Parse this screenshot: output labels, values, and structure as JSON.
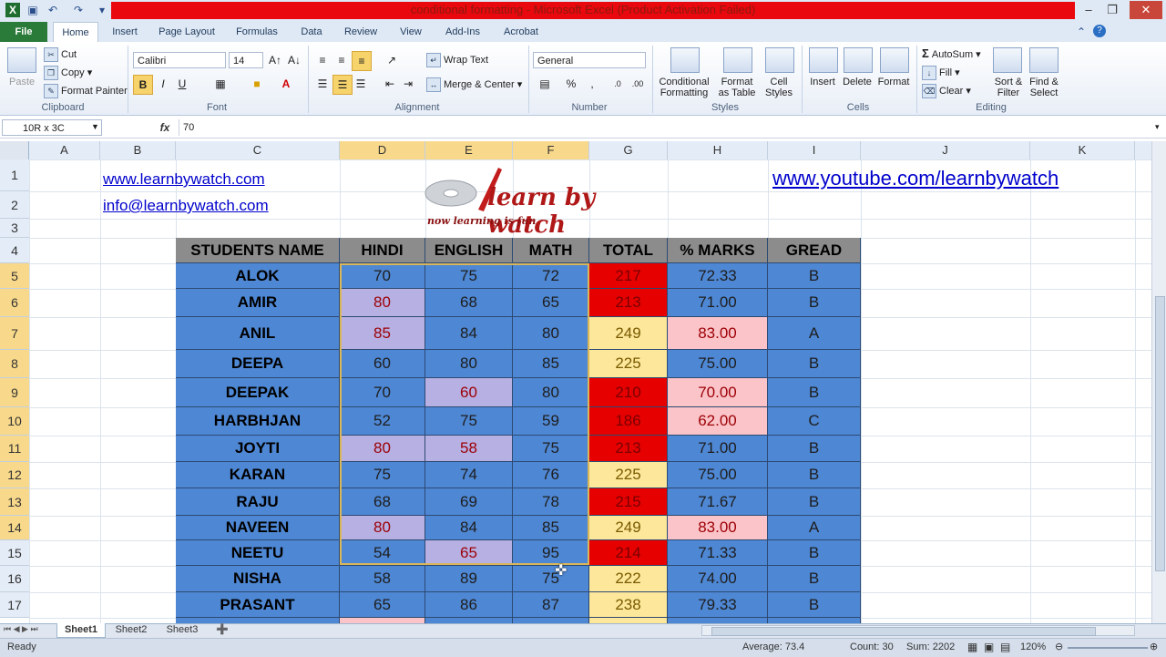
{
  "window": {
    "title": "conditional formatting - Microsoft Excel (Product Activation Failed)"
  },
  "ribbon_tabs": [
    "File",
    "Home",
    "Insert",
    "Page Layout",
    "Formulas",
    "Data",
    "Review",
    "View",
    "Add-Ins",
    "Acrobat"
  ],
  "clipboard": {
    "paste": "Paste",
    "cut": "Cut",
    "copy": "Copy",
    "format_painter": "Format Painter",
    "label": "Clipboard"
  },
  "font": {
    "name": "Calibri",
    "size": "14",
    "label": "Font"
  },
  "alignment": {
    "wrap": "Wrap Text",
    "merge": "Merge & Center",
    "label": "Alignment"
  },
  "number": {
    "format": "General",
    "label": "Number"
  },
  "styles": {
    "conditional": "Conditional",
    "conditional2": "Formatting",
    "format_table": "Format",
    "format_table2": "as Table",
    "cell_styles": "Cell",
    "cell_styles2": "Styles",
    "label": "Styles"
  },
  "cells": {
    "insert": "Insert",
    "delete": "Delete",
    "format": "Format",
    "label": "Cells"
  },
  "editing": {
    "autosum": "AutoSum",
    "fill": "Fill",
    "clear": "Clear",
    "sort": "Sort &",
    "sort2": "Filter",
    "find": "Find &",
    "find2": "Select",
    "label": "Editing"
  },
  "formula_bar": {
    "name_box": "10R x 3C",
    "fx": "fx",
    "value": "70"
  },
  "columns": [
    "A",
    "B",
    "C",
    "D",
    "E",
    "F",
    "G",
    "H",
    "I",
    "J",
    "K"
  ],
  "rows": [
    "1",
    "2",
    "3",
    "4",
    "5",
    "6",
    "7",
    "8",
    "9",
    "10",
    "11",
    "12",
    "13",
    "14",
    "15",
    "16",
    "17"
  ],
  "links": {
    "site": "www.learnbywatch.com",
    "email": "info@learnbywatch.com",
    "youtube": "www.youtube.com/learnbywatch"
  },
  "logo": {
    "text": "learn by watch",
    "tagline": "now learning is fun"
  },
  "table": {
    "headers": [
      "STUDENTS NAME",
      "HINDI",
      "ENGLISH",
      "MATH",
      "TOTAL",
      "% MARKS",
      "GREAD"
    ],
    "rows": [
      {
        "name": "ALOK",
        "hindi": "70",
        "english": "75",
        "math": "72",
        "total": "217",
        "marks": "72.33",
        "grade": "B"
      },
      {
        "name": "AMIR",
        "hindi": "80",
        "english": "68",
        "math": "65",
        "total": "213",
        "marks": "71.00",
        "grade": "B"
      },
      {
        "name": "ANIL",
        "hindi": "85",
        "english": "84",
        "math": "80",
        "total": "249",
        "marks": "83.00",
        "grade": "A"
      },
      {
        "name": "DEEPA",
        "hindi": "60",
        "english": "80",
        "math": "85",
        "total": "225",
        "marks": "75.00",
        "grade": "B"
      },
      {
        "name": "DEEPAK",
        "hindi": "70",
        "english": "60",
        "math": "80",
        "total": "210",
        "marks": "70.00",
        "grade": "B"
      },
      {
        "name": "HARBHJAN",
        "hindi": "52",
        "english": "75",
        "math": "59",
        "total": "186",
        "marks": "62.00",
        "grade": "C"
      },
      {
        "name": "JOYTI",
        "hindi": "80",
        "english": "58",
        "math": "75",
        "total": "213",
        "marks": "71.00",
        "grade": "B"
      },
      {
        "name": "KARAN",
        "hindi": "75",
        "english": "74",
        "math": "76",
        "total": "225",
        "marks": "75.00",
        "grade": "B"
      },
      {
        "name": "RAJU",
        "hindi": "68",
        "english": "69",
        "math": "78",
        "total": "215",
        "marks": "71.67",
        "grade": "B"
      },
      {
        "name": "NAVEEN",
        "hindi": "80",
        "english": "84",
        "math": "85",
        "total": "249",
        "marks": "83.00",
        "grade": "A"
      },
      {
        "name": "NEETU",
        "hindi": "54",
        "english": "65",
        "math": "95",
        "total": "214",
        "marks": "71.33",
        "grade": "B"
      },
      {
        "name": "NISHA",
        "hindi": "58",
        "english": "89",
        "math": "75",
        "total": "222",
        "marks": "74.00",
        "grade": "B"
      },
      {
        "name": "PRASANT",
        "hindi": "65",
        "english": "86",
        "math": "87",
        "total": "238",
        "marks": "79.33",
        "grade": "B"
      }
    ]
  },
  "sheets": [
    "Sheet1",
    "Sheet2",
    "Sheet3"
  ],
  "status": {
    "ready": "Ready",
    "average": "Average: 73.4",
    "count": "Count: 30",
    "sum": "Sum: 2202",
    "zoom": "120%"
  },
  "colors": {
    "blue_cell": "#4e87d3",
    "lavender": "#b7b0e2",
    "red_total": "#e60000",
    "yellow": "#fce79a",
    "pink": "#fbc4c8",
    "header_gray": "#8c8c8c"
  }
}
